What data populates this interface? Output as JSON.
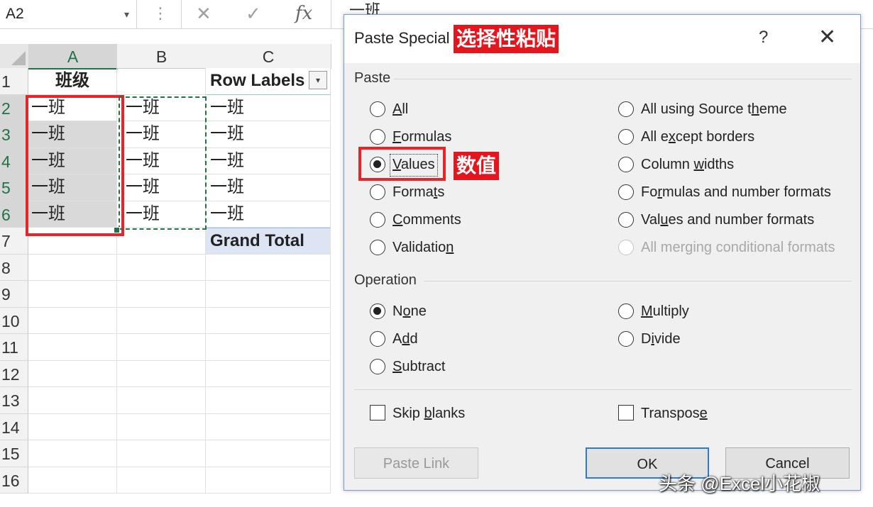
{
  "formula_bar": {
    "name_box": "A2",
    "name_box_dropdown": "▾",
    "dots": "⋮",
    "cancel_icon": "✕",
    "enter_icon": "✓",
    "fx_label": "fx",
    "value": "一班"
  },
  "sheet": {
    "columns": [
      "A",
      "B",
      "C"
    ],
    "rows": [
      "1",
      "2",
      "3",
      "4",
      "5",
      "6",
      "7",
      "8",
      "9",
      "10",
      "11",
      "12",
      "13",
      "14",
      "15",
      "16"
    ],
    "colA": [
      "班级",
      "一班",
      " 一班",
      "一班",
      " 一班",
      "一班"
    ],
    "colB": [
      "一班",
      "一班",
      "一班",
      "一班",
      "一班"
    ],
    "colC": [
      "Row Labels",
      " 一班",
      "一班",
      "一班",
      "一班",
      " 一班",
      "Grand Total"
    ],
    "pivot_dropdown": "▾"
  },
  "dialog": {
    "title": "Paste Special",
    "title_annotation": "选择性粘贴",
    "help": "?",
    "close": "✕",
    "paste_section": "Paste",
    "paste_left": [
      {
        "pre": "",
        "u": "A",
        "post": "ll",
        "selected": false
      },
      {
        "pre": "",
        "u": "F",
        "post": "ormulas",
        "selected": false
      },
      {
        "pre": "",
        "u": "V",
        "post": "alues",
        "selected": true
      },
      {
        "pre": "Forma",
        "u": "t",
        "post": "s",
        "selected": false
      },
      {
        "pre": "",
        "u": "C",
        "post": "omments",
        "selected": false
      },
      {
        "pre": "Validatio",
        "u": "n",
        "post": "",
        "selected": false
      }
    ],
    "paste_right": [
      {
        "pre": "All using Source t",
        "u": "h",
        "post": "eme",
        "disabled": false
      },
      {
        "pre": "All e",
        "u": "x",
        "post": "cept borders",
        "disabled": false
      },
      {
        "pre": "Column ",
        "u": "w",
        "post": "idths",
        "disabled": false
      },
      {
        "pre": "Fo",
        "u": "r",
        "post": "mulas and number formats",
        "disabled": false
      },
      {
        "pre": "Val",
        "u": "u",
        "post": "es and number formats",
        "disabled": false
      },
      {
        "pre": "All merging conditional formats",
        "u": "",
        "post": "",
        "disabled": true
      }
    ],
    "values_annotation": "数值",
    "operation_section": "Operation",
    "op_left": [
      {
        "pre": "N",
        "u": "o",
        "post": "ne",
        "selected": true
      },
      {
        "pre": "A",
        "u": "d",
        "post": "d",
        "selected": false
      },
      {
        "pre": "",
        "u": "S",
        "post": "ubtract",
        "selected": false
      }
    ],
    "op_right": [
      {
        "pre": "",
        "u": "M",
        "post": "ultiply"
      },
      {
        "pre": "D",
        "u": "i",
        "post": "vide"
      }
    ],
    "skip_blanks": {
      "pre": "Skip ",
      "u": "b",
      "post": "lanks"
    },
    "transpose": {
      "pre": "Transpos",
      "u": "e",
      "post": ""
    },
    "paste_link": "Paste Link",
    "ok": "OK",
    "cancel": "Cancel"
  },
  "watermark": "头条 @Excel小花椒"
}
